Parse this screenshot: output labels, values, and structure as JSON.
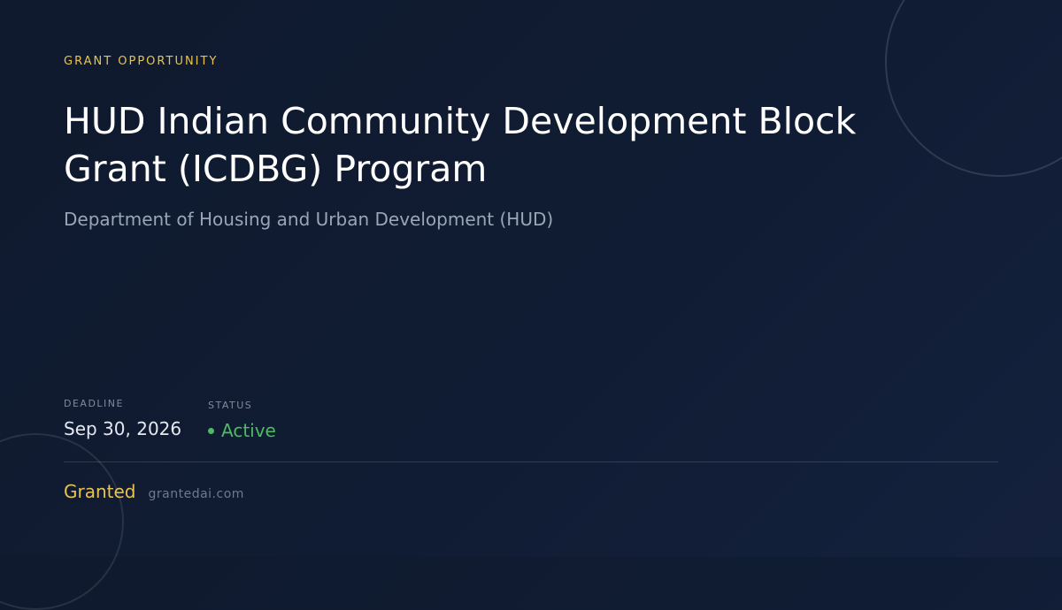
{
  "eyebrow": "GRANT OPPORTUNITY",
  "title": "HUD Indian Community Development Block Grant (ICDBG) Program",
  "agency": "Department of Housing and Urban Development (HUD)",
  "meta": {
    "deadline_label": "DEADLINE",
    "deadline_value": "Sep 30, 2026",
    "status_label": "STATUS",
    "status_value": "Active"
  },
  "footer": {
    "brand": "Granted",
    "site": "grantedai.com"
  },
  "colors": {
    "background": "#0f1a2e",
    "accent": "#e8c34f",
    "status_active": "#4cbb62",
    "muted_text": "#9aa5b8"
  }
}
